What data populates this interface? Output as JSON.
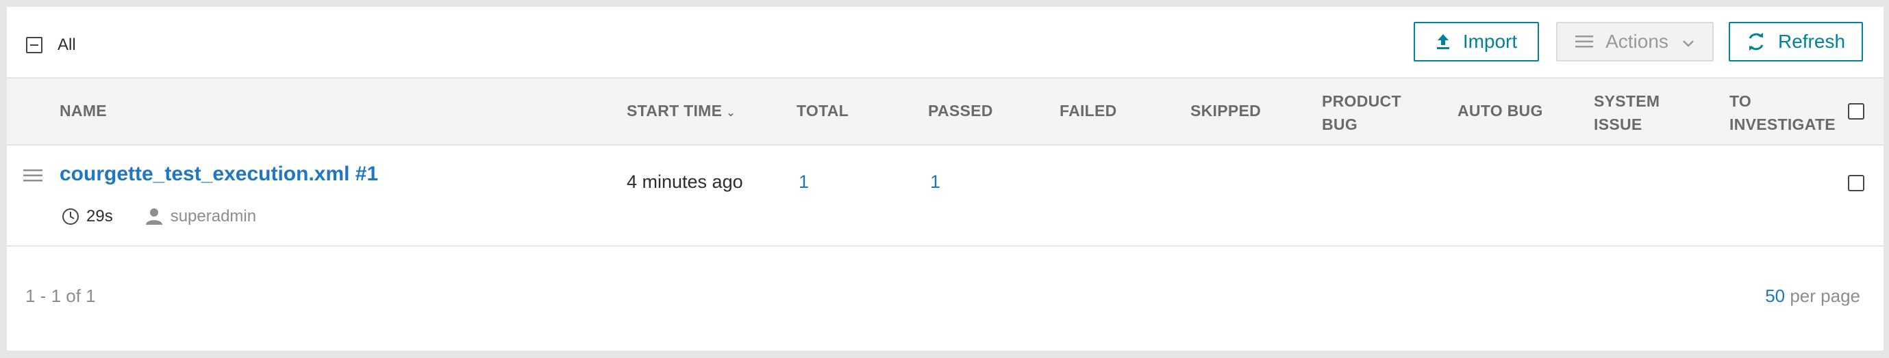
{
  "toolbar": {
    "select_all_label": "All",
    "import_label": "Import",
    "actions_label": "Actions",
    "refresh_label": "Refresh"
  },
  "table": {
    "headers": {
      "name": "NAME",
      "start_time": "START TIME",
      "total": "TOTAL",
      "passed": "PASSED",
      "failed": "FAILED",
      "skipped": "SKIPPED",
      "product_bug_l1": "PRODUCT",
      "product_bug_l2": "BUG",
      "auto_bug": "AUTO BUG",
      "system_issue_l1": "SYSTEM",
      "system_issue_l2": "ISSUE",
      "to_investigate_l1": "TO",
      "to_investigate_l2": "INVESTIGATE"
    },
    "rows": [
      {
        "name": "courgette_test_execution.xml #1",
        "duration": "29s",
        "owner": "superadmin",
        "start_time": "4 minutes ago",
        "total": "1",
        "passed": "1"
      }
    ]
  },
  "pagination": {
    "range": "1 - 1 of 1",
    "per_page_value": "50",
    "per_page_label": "per page"
  },
  "colors": {
    "accent": "#00829b",
    "link": "#1f76c4"
  },
  "icons": [
    "minus-checkbox-icon",
    "upload-icon",
    "hamburger-icon",
    "chevron-down-icon",
    "refresh-icon",
    "clock-icon",
    "user-icon",
    "row-menu-icon"
  ]
}
